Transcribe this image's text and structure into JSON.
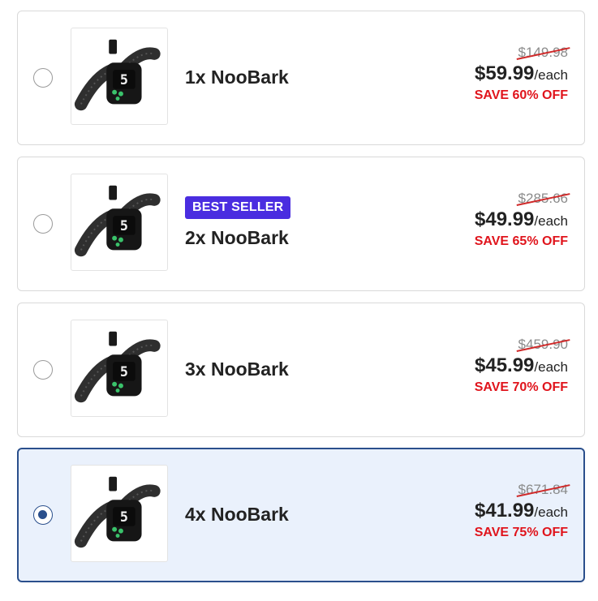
{
  "options": [
    {
      "name": "1x NooBark",
      "badge": "",
      "old_price": "$149.98",
      "price": "$59.99",
      "per": "/each",
      "save": "SAVE 60% OFF",
      "selected": false
    },
    {
      "name": "2x NooBark",
      "badge": "BEST SELLER",
      "old_price": "$285.66",
      "price": "$49.99",
      "per": "/each",
      "save": "SAVE 65% OFF",
      "selected": false
    },
    {
      "name": "3x NooBark",
      "badge": "",
      "old_price": "$459.90",
      "price": "$45.99",
      "per": "/each",
      "save": "SAVE 70% OFF",
      "selected": false
    },
    {
      "name": "4x NooBark",
      "badge": "",
      "old_price": "$671.84",
      "price": "$41.99",
      "per": "/each",
      "save": "SAVE 75% OFF",
      "selected": true
    }
  ],
  "colors": {
    "accent": "#2a4f8c",
    "selected_bg": "#eaf1fc",
    "badge": "#4a2de0",
    "save": "#e0141c"
  },
  "product_image": "dog-bark-collar-image"
}
